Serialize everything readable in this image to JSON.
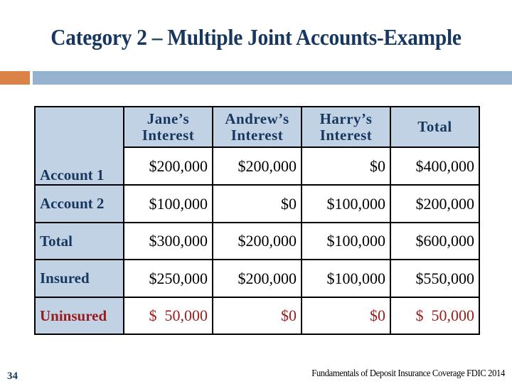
{
  "slide": {
    "title": "Category 2 – Multiple Joint Accounts-Example",
    "number": "34",
    "footer": "Fundamentals of Deposit Insurance Coverage FDIC 2014",
    "colors": {
      "title": "#17375E",
      "accent_orange": "#DB8248",
      "accent_blue": "#95B3D0",
      "table_header_bg": "#C0D2E4",
      "uninsured_red": "#9B1C1C"
    }
  },
  "table": {
    "headers": [
      "",
      "Jane’s Interest",
      "Andrew’s Interest",
      "Harry’s Interest",
      "Total"
    ],
    "header_lines": [
      [
        "",
        ""
      ],
      [
        "Jane’s",
        "Interest"
      ],
      [
        "Andrew’s",
        "Interest"
      ],
      [
        "Harry’s",
        "Interest"
      ],
      [
        "Total",
        ""
      ]
    ],
    "rows": [
      {
        "label": "Account 1",
        "cells": [
          "$200,000",
          "$200,000",
          "$0",
          "$400,000"
        ]
      },
      {
        "label": "Account 2",
        "cells": [
          "$100,000",
          "$0",
          "$100,000",
          "$200,000"
        ]
      },
      {
        "label": "Total",
        "cells": [
          "$300,000",
          "$200,000",
          "$100,000",
          "$600,000"
        ]
      },
      {
        "label": "Insured",
        "cells": [
          "$250,000",
          "$200,000",
          "$100,000",
          "$550,000"
        ]
      },
      {
        "label": "Uninsured",
        "cells": [
          "$  50,000",
          "$0",
          "$0",
          "$  50,000"
        ]
      }
    ]
  }
}
